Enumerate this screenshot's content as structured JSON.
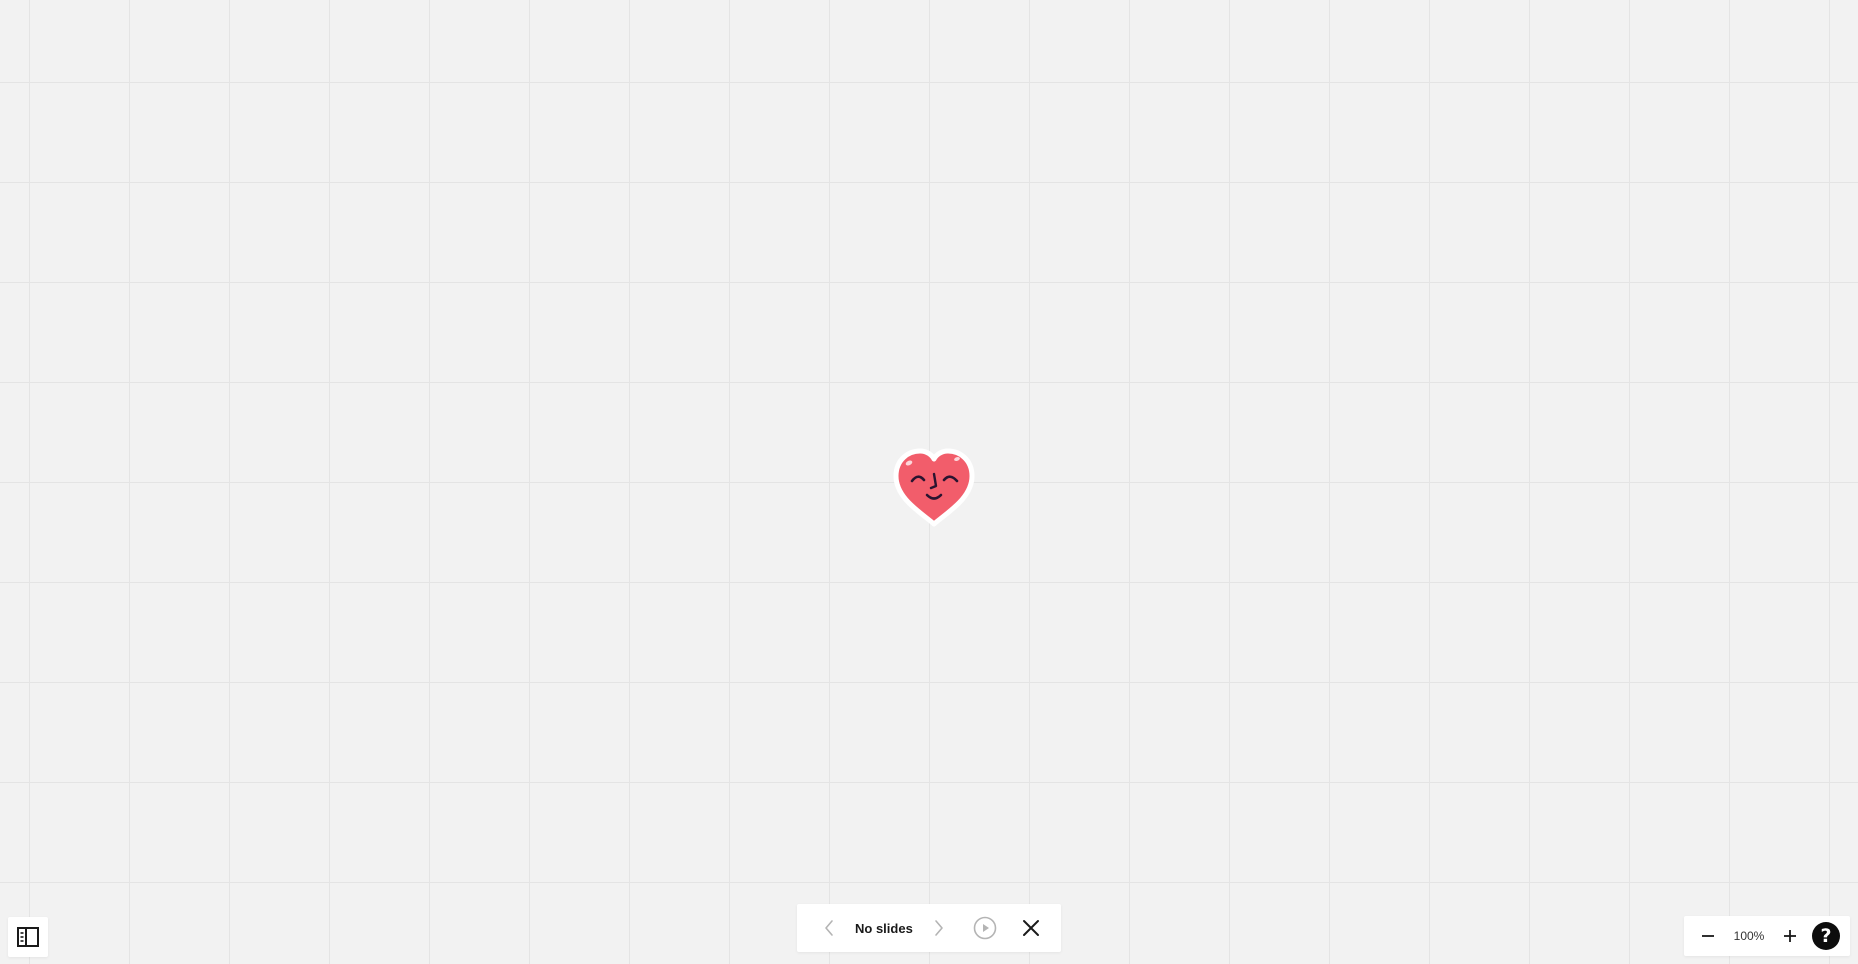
{
  "canvas": {
    "background": "#f2f2f2",
    "grid_color": "#e4e4e4",
    "sticker": {
      "icon": "smiling-heart-sticker",
      "fill": "#f25d6b",
      "outline": "#ffffff",
      "face": "#2a1430"
    }
  },
  "sidebar": {
    "toggle_icon": "panel-left-icon"
  },
  "slides": {
    "status_label": "No slides",
    "prev_icon": "chevron-left-icon",
    "next_icon": "chevron-right-icon",
    "play_icon": "play-circle-icon",
    "close_icon": "close-icon"
  },
  "zoom": {
    "out_icon": "minus-icon",
    "level": "100%",
    "in_icon": "plus-icon",
    "help_label": "?"
  }
}
